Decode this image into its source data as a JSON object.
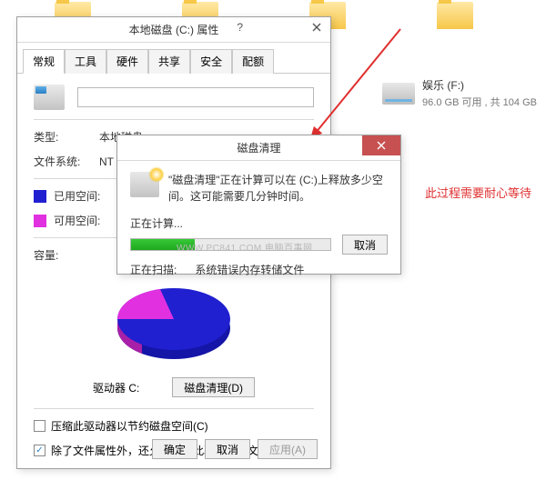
{
  "desktop": {
    "drive": {
      "title": "娱乐 (F:)",
      "sub": "96.0 GB 可用 , 共 104 GB"
    }
  },
  "props": {
    "title": "本地磁盘 (C:) 属性",
    "tabs": [
      "常规",
      "工具",
      "硬件",
      "共享",
      "安全",
      "配额"
    ],
    "name_value": "",
    "type_label": "类型:",
    "type_value": "本地磁盘",
    "fs_label": "文件系统:",
    "fs_value": "NT",
    "used_label": "已用空间:",
    "free_label": "可用空间:",
    "cap_label": "容量:",
    "drv_label": "驱动器 C:",
    "clean_btn": "磁盘清理(D)",
    "chk1": "压缩此驱动器以节约磁盘空间(C)",
    "chk2": "除了文件属性外，还允许索引此驱动器上文件的内容(I)",
    "ok": "确定",
    "cancel": "取消",
    "apply": "应用(A)"
  },
  "dlg": {
    "title": "磁盘清理",
    "text": "\"磁盘清理\"正在计算可以在 (C:)上释放多少空间。这可能需要几分钟时间。",
    "calc": "正在计算...",
    "watermark": "WWW.PC841.COM 电脑百事网",
    "cancel": "取消",
    "scan_label": "正在扫描:",
    "scan_value": "系统错误内存转储文件"
  },
  "note": "此过程需要耐心等待"
}
